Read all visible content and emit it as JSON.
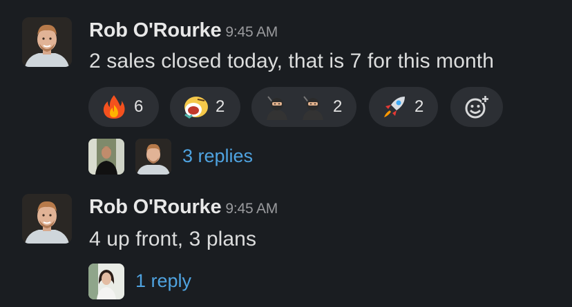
{
  "messages": [
    {
      "author": "Rob O'Rourke",
      "time": "9:45 AM",
      "text": "2 sales closed today, that is 7 for this month",
      "reactions": [
        {
          "emoji": "fire-icon",
          "count": "6"
        },
        {
          "emoji": "screaming-face-icon",
          "count": "2"
        },
        {
          "emoji": "ninja-icon",
          "count": "2"
        },
        {
          "emoji": "rocket-icon",
          "count": "2"
        }
      ],
      "add_reaction_icon": "add-reaction-icon",
      "replies": "3 replies"
    },
    {
      "author": "Rob O'Rourke",
      "time": "9:45 AM",
      "text": "4 up front, 3 plans",
      "replies": "1 reply"
    }
  ],
  "colors": {
    "background": "#1a1d21",
    "pill": "#2c2f34",
    "link": "#4fa3e0",
    "timestamp": "#9a9b9e"
  }
}
